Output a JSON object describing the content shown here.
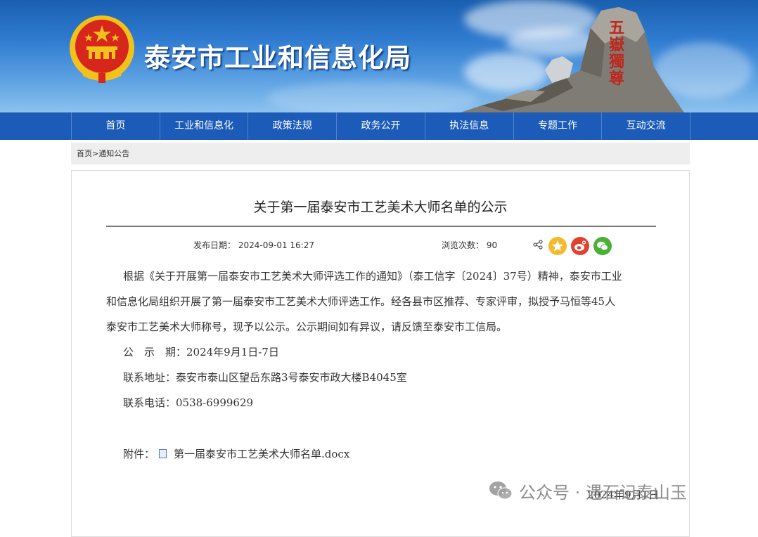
{
  "header": {
    "site_title": "泰安市工业和信息化局",
    "rock_inscription": "五嶽獨尊",
    "colors": {
      "banner_top": "#1a5fb0",
      "nav_bg": "#1c5cb8",
      "emblem_red": "#d7261b",
      "emblem_gold": "#f2c21c"
    }
  },
  "nav": {
    "items": [
      "首页",
      "工业和信息化",
      "政策法规",
      "政务公开",
      "执法信息",
      "专题工作",
      "互动交流"
    ]
  },
  "breadcrumb": {
    "home": "首页",
    "sep": ">",
    "current": "通知公告"
  },
  "article": {
    "title": "关于第一届泰安市工艺美术大师名单的公示",
    "publish_label": "发布日期：",
    "publish_value": "2024-09-01 16:27",
    "views_label": "浏览次数：",
    "views_value": "90",
    "share_icons": [
      "share-icon",
      "qzone-icon",
      "weibo-icon",
      "wechat-icon"
    ],
    "paragraph_line1": "根据《关于开展第一届泰安市工艺美术大师评选工作的通知》（泰工信字〔2024〕37号）精神，泰安市工业",
    "paragraph_line2": "和信息化局组织开展了第一届泰安市工艺美术大师评选工作。经各县市区推荐、专家评审，拟授予马恒等45人",
    "paragraph_line3": "泰安市工艺美术大师称号，现予以公示。公示期间如有异议，请反馈至泰安市工信局。",
    "period": "公　示　期：2024年9月1日-7日",
    "address": "联系地址：泰安市泰山区望岳东路3号泰安市政大楼B4045室",
    "phone": "联系电话：0538-6999629",
    "attachment_label": "附件：",
    "attachment_name": "第一届泰安市工艺美术大师名单.docx",
    "sign_date": "2024年9月1日"
  },
  "watermark": {
    "text": "公众号 · 遇石记泰山玉"
  }
}
